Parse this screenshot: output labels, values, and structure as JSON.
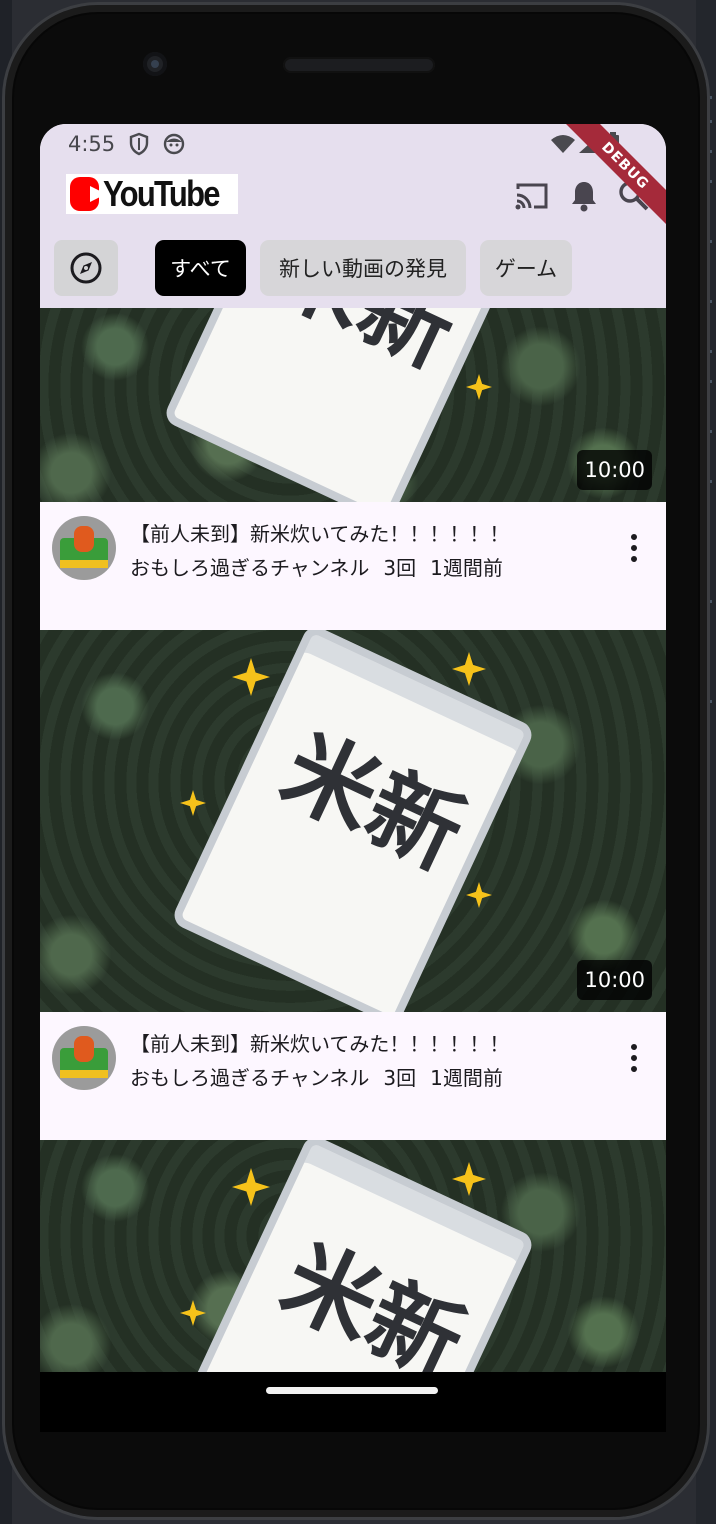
{
  "status_bar": {
    "time": "4:55"
  },
  "debug_banner": "DEBUG",
  "app_bar": {
    "logo_text": "YouTube",
    "logo_colors": {
      "play": "#ff0000",
      "word": "#111111"
    }
  },
  "chips": [
    {
      "label": "すべて",
      "selected": true
    },
    {
      "label": "新しい動画の発見",
      "selected": false
    },
    {
      "label": "ゲーム",
      "selected": false
    }
  ],
  "thumbnail_text": "新米",
  "videos": [
    {
      "duration": "10:00",
      "title": "【前人未到】新米炊いてみた！！！！！！",
      "channel": "おもしろ過ぎるチャンネル",
      "views": "3回",
      "age": "1週間前"
    },
    {
      "duration": "10:00",
      "title": "【前人未到】新米炊いてみた！！！！！！",
      "channel": "おもしろ過ぎるチャンネル",
      "views": "3回",
      "age": "1週間前"
    }
  ],
  "colors": {
    "app_bar_bg": "#e6dfee",
    "feed_bg": "#fdf7ff",
    "chip_selected": "#000000",
    "chip_default": "#d7d6d9",
    "debug_banner": "#a52a3a",
    "sparkle": "#f6c21a"
  },
  "icons": [
    "explore-icon",
    "cast-icon",
    "notifications-icon",
    "search-icon",
    "more-vert-icon",
    "wifi-icon",
    "cell-signal-icon",
    "battery-icon",
    "shield-icon"
  ]
}
